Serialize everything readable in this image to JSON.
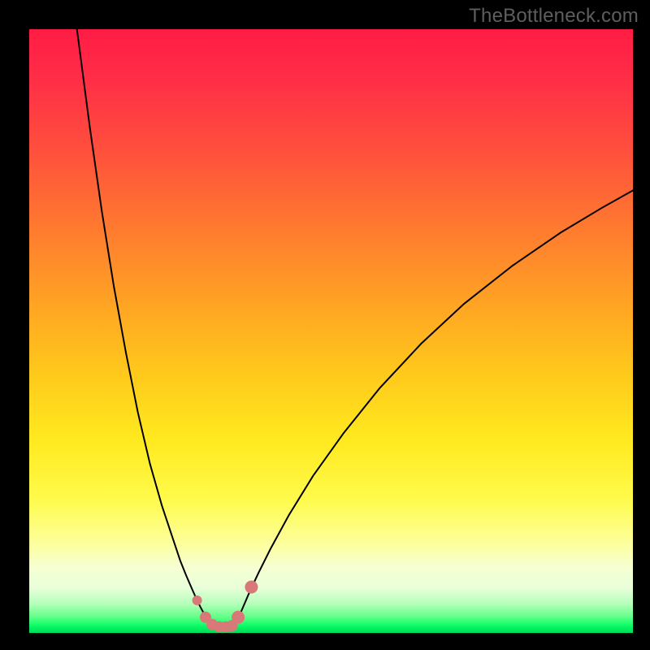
{
  "watermark": "TheBottleneck.com",
  "chart_data": {
    "type": "line",
    "title": "",
    "xlabel": "",
    "ylabel": "",
    "xlim": [
      0,
      100
    ],
    "ylim": [
      0,
      100
    ],
    "grid": false,
    "legend": false,
    "series": [
      {
        "name": "left-branch",
        "x": [
          7.9,
          10,
          12,
          14,
          16,
          18,
          20,
          22,
          24,
          25,
          26,
          27,
          27.8,
          28.4,
          29.0,
          29.6,
          30.0
        ],
        "y": [
          100,
          84,
          70,
          57.5,
          46.5,
          36.5,
          28,
          21,
          15,
          12,
          9.5,
          7.2,
          5.4,
          4.2,
          3.1,
          2.1,
          1.6
        ]
      },
      {
        "name": "right-branch",
        "x": [
          34.2,
          34.6,
          35.3,
          36.5,
          38,
          40,
          43,
          47,
          52,
          58,
          65,
          72,
          80,
          88,
          95,
          100
        ],
        "y": [
          1.6,
          2.4,
          4.0,
          6.8,
          10.0,
          14.0,
          19.5,
          26.0,
          33.0,
          40.5,
          48.0,
          54.5,
          60.8,
          66.3,
          70.5,
          73.3
        ]
      }
    ],
    "valley_floor": {
      "name": "valley-floor",
      "x_range": [
        30.0,
        34.2
      ],
      "y": 1.6
    },
    "markers": [
      {
        "x": 27.8,
        "y": 5.4,
        "r": 6
      },
      {
        "x": 29.2,
        "y": 2.6,
        "r": 7
      },
      {
        "x": 30.3,
        "y": 1.4,
        "r": 7
      },
      {
        "x": 31.5,
        "y": 1.0,
        "r": 7
      },
      {
        "x": 32.6,
        "y": 1.0,
        "r": 7
      },
      {
        "x": 33.6,
        "y": 1.2,
        "r": 7
      },
      {
        "x": 34.6,
        "y": 2.6,
        "r": 8
      },
      {
        "x": 36.8,
        "y": 7.6,
        "r": 8
      }
    ],
    "background_gradient_note": "Vertical gradient: red at top through orange/yellow to bright green at bottom; qualitative, no numeric scale shown."
  }
}
